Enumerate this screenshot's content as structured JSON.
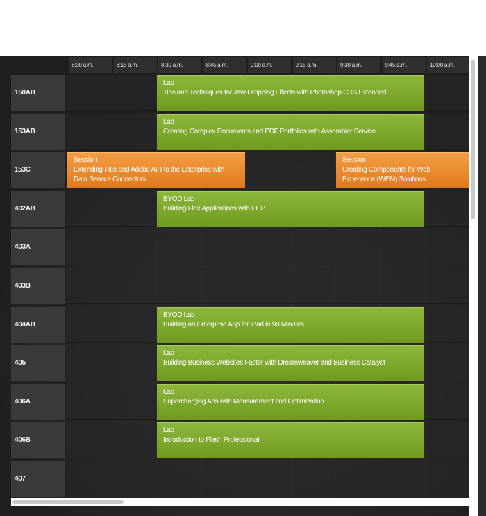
{
  "time_slots": [
    "8:00 a.m.",
    "8:15 a.m.",
    "8:30 a.m.",
    "8:45 a.m.",
    "9:00 a.m.",
    "9:15 a.m.",
    "9:30 a.m.",
    "9:45 a.m.",
    "10:00 a.m."
  ],
  "rooms": [
    "150AB",
    "153AB",
    "153C",
    "402AB",
    "403A",
    "403B",
    "404AB",
    "405",
    "406A",
    "406B",
    "407"
  ],
  "events": [
    {
      "room": "150AB",
      "type": "Lab",
      "title": "Tips and Techniques for Jaw-Dropping Effects with Photoshop CSS Extended",
      "start": "8:30 a.m.",
      "end": "10:00 a.m.",
      "color": "green"
    },
    {
      "room": "153AB",
      "type": "Lab",
      "title": "Creating Complex Documents and PDF Portfolios with Assembler Service",
      "start": "8:30 a.m.",
      "end": "10:00 a.m.",
      "color": "green"
    },
    {
      "room": "153C",
      "type": "Session",
      "title": "Extending Flex and Adobe AIR to the Enterprise with Data Service Connectors",
      "start": "8:00 a.m.",
      "end": "9:00 a.m.",
      "color": "orange"
    },
    {
      "room": "153C",
      "type": "Session",
      "title": "Creating Components for Web Experience (WEM) Solutions",
      "start": "9:30 a.m.",
      "end": "10:30 a.m.",
      "color": "orange"
    },
    {
      "room": "402AB",
      "type": "BYOD Lab",
      "title": "Building Flex Applications with PHP",
      "start": "8:30 a.m.",
      "end": "10:00 a.m.",
      "color": "green"
    },
    {
      "room": "404AB",
      "type": "BYOD Lab",
      "title": "Building an Enterprise App for iPad in 90 Minutes",
      "start": "8:30 a.m.",
      "end": "10:00 a.m.",
      "color": "green"
    },
    {
      "room": "405",
      "type": "Lab",
      "title": "Building Business Websites Faster with Dreamweaver and Business Catalyst",
      "start": "8:30 a.m.",
      "end": "10:00 a.m.",
      "color": "green"
    },
    {
      "room": "406A",
      "type": "Lab",
      "title": "Supercharging Ads with Measurement and Optimization",
      "start": "8:30 a.m.",
      "end": "10:00 a.m.",
      "color": "green"
    },
    {
      "room": "406B",
      "type": "Lab",
      "title": "Introduction to Flash Professional",
      "start": "8:30 a.m.",
      "end": "10:00 a.m.",
      "color": "green"
    }
  ],
  "colors": {
    "green": "#7ba62b",
    "orange": "#ea8a2e",
    "background": "#262626"
  }
}
